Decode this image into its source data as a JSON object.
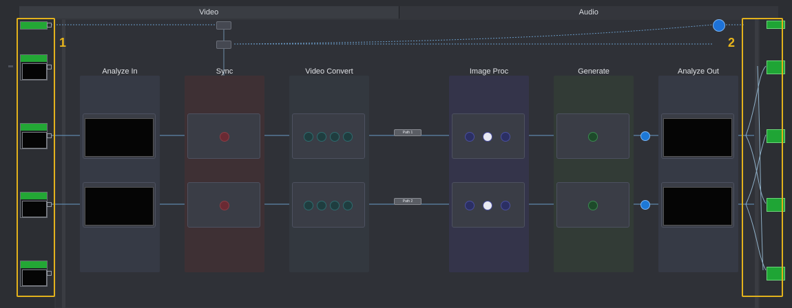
{
  "tabs": {
    "video": "Video",
    "audio": "Audio"
  },
  "lanes": [
    {
      "title": "Analyze In"
    },
    {
      "title": "Sync"
    },
    {
      "title": "Video Convert"
    },
    {
      "title": "Image Proc"
    },
    {
      "title": "Generate"
    },
    {
      "title": "Analyze Out"
    }
  ],
  "path_labels": [
    "Path 1",
    "Path 2"
  ],
  "annotations": {
    "left_number": "1",
    "right_number": "2"
  },
  "colors": {
    "selection": "#e3b21c",
    "input_green": "#23a735",
    "connector_blue": "#1d78d6"
  }
}
